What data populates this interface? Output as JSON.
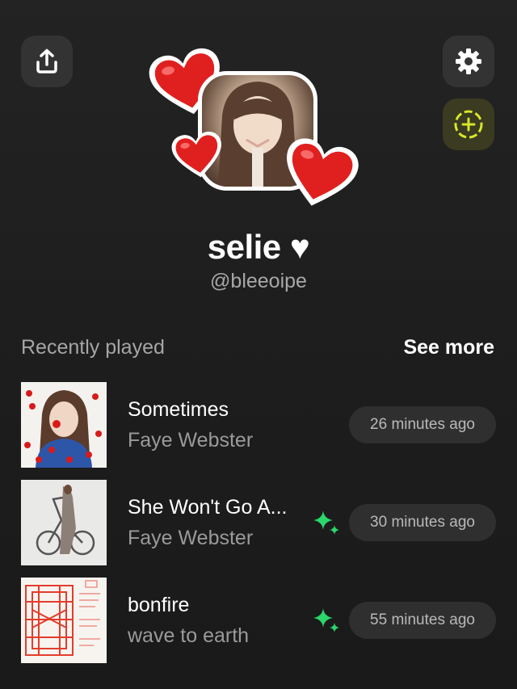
{
  "profile": {
    "display_name": "selie",
    "heart_glyph": "♥",
    "handle": "@bleeoipe"
  },
  "recently_played": {
    "title": "Recently played",
    "see_more_label": "See more",
    "tracks": [
      {
        "title": "Sometimes",
        "artist": "Faye Webster",
        "time_ago": "26 minutes ago",
        "has_sparkle": false
      },
      {
        "title": "She Won't Go A...",
        "artist": "Faye Webster",
        "time_ago": "30 minutes ago",
        "has_sparkle": true
      },
      {
        "title": "bonfire",
        "artist": "wave to earth",
        "time_ago": "55 minutes ago",
        "has_sparkle": true
      }
    ]
  },
  "icons": {
    "share": "share-icon",
    "settings": "gear-icon",
    "add_story": "add-story-icon",
    "sparkle": "sparkle-icon",
    "heart": "heart-emoji"
  },
  "colors": {
    "background": "#1f1f1f",
    "button_bg": "#333333",
    "story_accent": "#d8e62a",
    "sparkle": "#2bd66b",
    "heart_red": "#e0201f"
  }
}
